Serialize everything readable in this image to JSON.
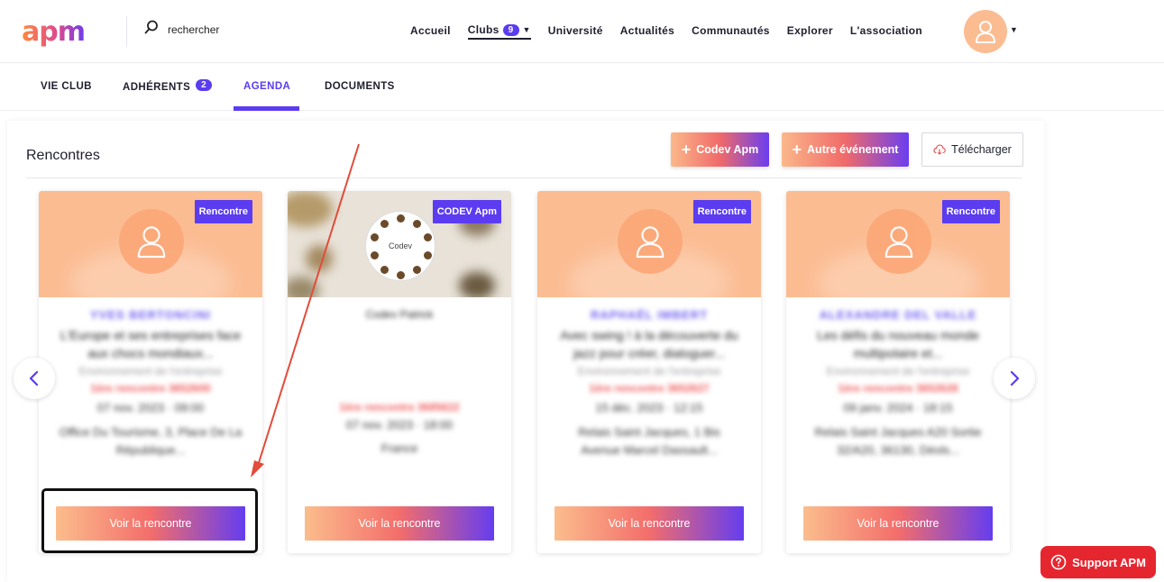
{
  "header": {
    "logo": "apm",
    "search": {
      "placeholder": "rechercher"
    },
    "nav": [
      {
        "label": "Accueil"
      },
      {
        "label": "Clubs",
        "badge": "9",
        "has_dropdown": true,
        "active": true
      },
      {
        "label": "Université"
      },
      {
        "label": "Actualités"
      },
      {
        "label": "Communautés"
      },
      {
        "label": "Explorer"
      },
      {
        "label": "L'association"
      }
    ]
  },
  "tabs": [
    {
      "label": "VIE CLUB"
    },
    {
      "label": "ADHÉRENTS",
      "badge": "2"
    },
    {
      "label": "AGENDA",
      "active": true
    },
    {
      "label": "DOCUMENTS"
    }
  ],
  "section": {
    "title": "Rencontres",
    "buttons": {
      "codev": "Codev Apm",
      "other": "Autre événement",
      "download": "Télécharger"
    }
  },
  "cards": [
    {
      "tag": "Rencontre",
      "name": "YVES BERTONCINI",
      "title": "L'Europe et ses entreprises face aux chocs mondiaux...",
      "category": "Environnement de l'entreprise",
      "number": "1ère rencontre 3652600",
      "date": "07 nov. 2023 · 09:00",
      "location": "Office Du Tourisme, 3, Place De La République...",
      "button": "Voir la rencontre"
    },
    {
      "tag": "CODEV Apm",
      "name": "Codev Patrick",
      "title": "",
      "category": "",
      "number": "1ère rencontre 3685622",
      "date": "07 nov. 2023 · 18:00",
      "location": "France",
      "button": "Voir la rencontre",
      "wheel_text": "Codev"
    },
    {
      "tag": "Rencontre",
      "name": "RAPHAËL IMBERT",
      "title": "Avec swing ! à la découverte du jazz pour créer, dialoguer...",
      "category": "Environnement de l'entreprise",
      "number": "1ère rencontre 3652627",
      "date": "15 déc. 2023 · 12:15",
      "location": "Relais Saint Jacques, 1 Bis Avenue Marcel Dassault...",
      "button": "Voir la rencontre"
    },
    {
      "tag": "Rencontre",
      "name": "ALEXANDRE DEL VALLE",
      "title": "Les défis du nouveau monde multipolaire et...",
      "category": "Environnement de l'entreprise",
      "number": "1ère rencontre 3652628",
      "date": "09 janv. 2024 · 18:15",
      "location": "Relais Saint Jacques A20 Sortie 32/A20, 36130, Déols...",
      "button": "Voir la rencontre"
    }
  ],
  "support": {
    "label": "Support APM"
  },
  "colors": {
    "accent": "#5b3cf0",
    "avatar": "#fbbc92",
    "support": "#e6262f"
  }
}
